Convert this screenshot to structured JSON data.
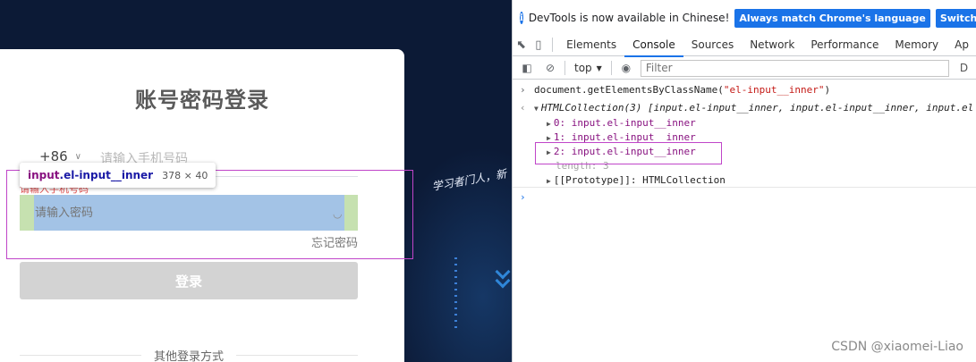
{
  "login": {
    "title": "账号密码登录",
    "country_code": "+86",
    "phone_placeholder": "请输入手机号码",
    "phone_error": "请输入手机号码",
    "password_placeholder": "请输入密码",
    "forgot_password": "忘记密码",
    "login_button": "登录",
    "other_methods": "其他登录方式",
    "slogan": "学习者门人，新"
  },
  "inspector": {
    "element_tag": "input",
    "element_class": ".el-input__inner",
    "element_size": "378 × 40"
  },
  "devtools": {
    "banner": {
      "message": "DevTools is now available in Chinese!",
      "button1": "Always match Chrome's language",
      "button2": "Switch DevTools"
    },
    "tabs": [
      "Elements",
      "Console",
      "Sources",
      "Network",
      "Performance",
      "Memory",
      "Ap"
    ],
    "active_tab": "Console",
    "toolbar": {
      "context": "top",
      "filter_placeholder": "Filter",
      "right_label": "D"
    },
    "console": {
      "command_prefix": "document.getElementsByClassName(",
      "command_arg": "\"el-input__inner\"",
      "command_suffix": ")",
      "result_head": "HTMLCollection(3) [input.el-input__inner, input.el-input__inner, input.el",
      "items": [
        {
          "index": "0:",
          "value": "input.el-input__inner"
        },
        {
          "index": "1:",
          "value": "input.el-input__inner"
        },
        {
          "index": "2:",
          "value": "input.el-input__inner"
        }
      ],
      "length_line": "length: 3",
      "prototype_line": "[[Prototype]]: HTMLCollection"
    }
  },
  "watermark": "CSDN @xiaomei-Liao",
  "colors": {
    "page_bg": "#0c1a36",
    "highlight_content": "#a3c3e6",
    "highlight_padding": "#c6e1b0",
    "inspector_border": "#c045c9",
    "devtools_accent": "#1a73e8",
    "error": "#e04d4d"
  }
}
